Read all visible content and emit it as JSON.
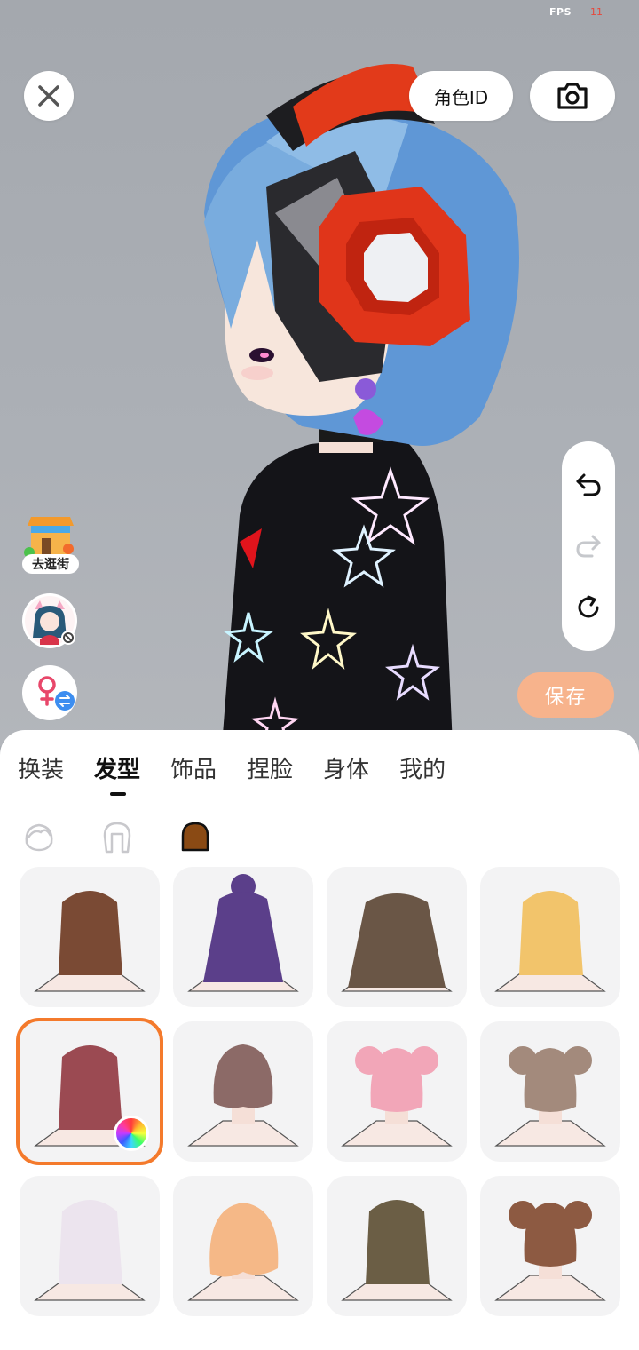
{
  "status": {
    "fps_label": "FPS",
    "fps_value": "11"
  },
  "top_bar": {
    "role_id_label": "角色ID"
  },
  "left_tools": {
    "shop_label": "去逛街"
  },
  "save_label": "保存",
  "tabs": [
    {
      "label": "换装",
      "active": false
    },
    {
      "label": "发型",
      "active": true
    },
    {
      "label": "饰品",
      "active": false
    },
    {
      "label": "捏脸",
      "active": false
    },
    {
      "label": "身体",
      "active": false
    },
    {
      "label": "我的",
      "active": false
    }
  ],
  "colors": {
    "accent": "#f47a2c",
    "save_bg": "#f7b38c",
    "headphone": "#e23a1a",
    "hair": "#5f97d6"
  },
  "hair_items": [
    {
      "name": "brown-long",
      "color": "#7a4a34"
    },
    {
      "name": "purple-bun-long",
      "color": "#5b3f8a"
    },
    {
      "name": "taupe-long",
      "color": "#6a5646"
    },
    {
      "name": "blonde-braids",
      "color": "#f2c46b"
    },
    {
      "name": "red-bob",
      "color": "#9b4a52",
      "selected": true
    },
    {
      "name": "mauve-short",
      "color": "#8c6a67"
    },
    {
      "name": "pink-buns",
      "color": "#f2a6b8"
    },
    {
      "name": "ash-buns",
      "color": "#a38a7c"
    },
    {
      "name": "white-twintail",
      "color": "#ece4ee"
    },
    {
      "name": "peach-short",
      "color": "#f5b887"
    },
    {
      "name": "olive-bob",
      "color": "#6b5e45"
    },
    {
      "name": "brown-buns-bob",
      "color": "#8d5a42"
    }
  ]
}
